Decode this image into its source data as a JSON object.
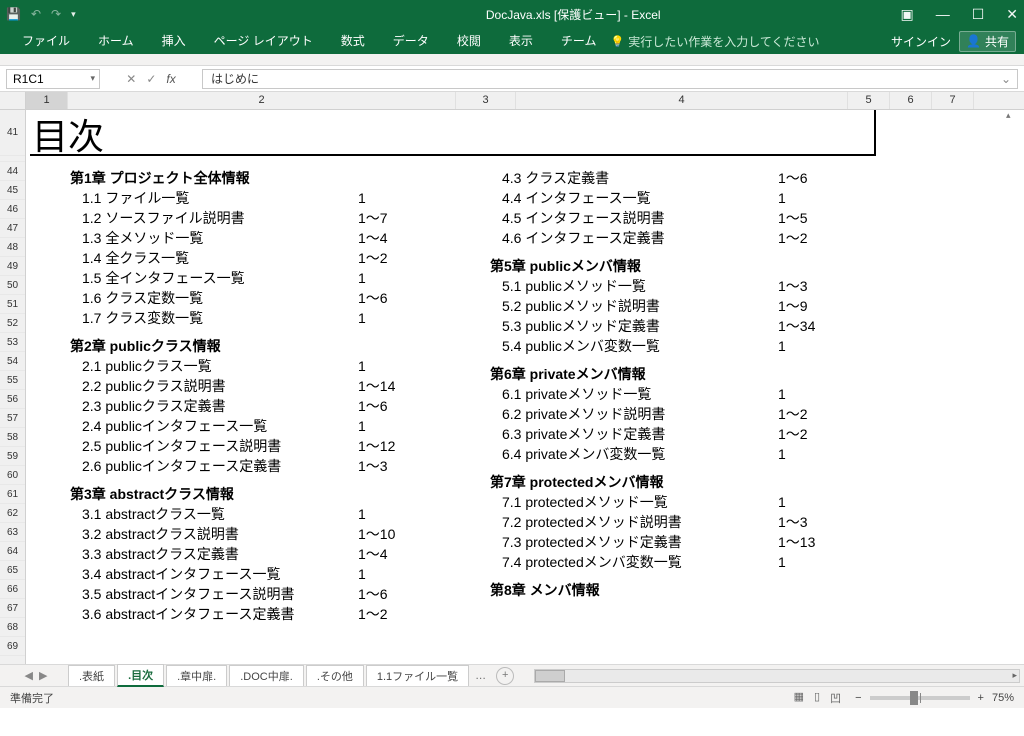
{
  "titlebar": {
    "doc_title": "DocJava.xls  [保護ビュー] - Excel"
  },
  "ribbon": {
    "tabs": [
      "ファイル",
      "ホーム",
      "挿入",
      "ページ レイアウト",
      "数式",
      "データ",
      "校閲",
      "表示",
      "チーム"
    ],
    "tell_me": "実行したい作業を入力してください",
    "signin": "サインイン",
    "share": "共有"
  },
  "fbar": {
    "namebox": "R1C1",
    "formula": "はじめに"
  },
  "columns": {
    "c1": "1",
    "c2": "2",
    "c3": "3",
    "c4": "4",
    "c5": "5",
    "c6": "6",
    "c7": "7"
  },
  "rows": [
    "41",
    "",
    "44",
    "45",
    "46",
    "47",
    "48",
    "49",
    "50",
    "51",
    "52",
    "53",
    "54",
    "55",
    "56",
    "57",
    "58",
    "59",
    "60",
    "61",
    "62",
    "63",
    "64",
    "65",
    "66",
    "67",
    "68",
    "69"
  ],
  "doc": {
    "title": "目次",
    "left": {
      "ch1": "第1章 プロジェクト全体情報",
      "s1_1": "1.1 ファイル一覧",
      "p1_1": "1",
      "s1_2": "1.2 ソースファイル説明書",
      "p1_2": "1～7",
      "s1_3": "1.3 全メソッド一覧",
      "p1_3": "1～4",
      "s1_4": "1.4 全クラス一覧",
      "p1_4": "1～2",
      "s1_5": "1.5 全インタフェース一覧",
      "p1_5": "1",
      "s1_6": "1.6 クラス定数一覧",
      "p1_6": "1～6",
      "s1_7": "1.7 クラス変数一覧",
      "p1_7": "1",
      "ch2": "第2章 publicクラス情報",
      "s2_1": "2.1 publicクラス一覧",
      "p2_1": "1",
      "s2_2": "2.2 publicクラス説明書",
      "p2_2": "1～14",
      "s2_3": "2.3 publicクラス定義書",
      "p2_3": "1～6",
      "s2_4": "2.4 publicインタフェース一覧",
      "p2_4": "1",
      "s2_5": "2.5 publicインタフェース説明書",
      "p2_5": "1～12",
      "s2_6": "2.6 publicインタフェース定義書",
      "p2_6": "1～3",
      "ch3": "第3章 abstractクラス情報",
      "s3_1": "3.1 abstractクラス一覧",
      "p3_1": "1",
      "s3_2": "3.2 abstractクラス説明書",
      "p3_2": "1～10",
      "s3_3": "3.3 abstractクラス定義書",
      "p3_3": "1～4",
      "s3_4": "3.4 abstractインタフェース一覧",
      "p3_4": "1",
      "s3_5": "3.5 abstractインタフェース説明書",
      "p3_5": "1～6",
      "s3_6": "3.6 abstractインタフェース定義書",
      "p3_6": "1～2"
    },
    "right": {
      "s4_3": "4.3 クラス定義書",
      "p4_3": "1～6",
      "s4_4": "4.4 インタフェース一覧",
      "p4_4": "1",
      "s4_5": "4.5 インタフェース説明書",
      "p4_5": "1～5",
      "s4_6": "4.6 インタフェース定義書",
      "p4_6": "1～2",
      "ch5": "第5章 publicメンバ情報",
      "s5_1": "5.1 publicメソッド一覧",
      "p5_1": "1～3",
      "s5_2": "5.2 publicメソッド説明書",
      "p5_2": "1～9",
      "s5_3": "5.3 publicメソッド定義書",
      "p5_3": "1～34",
      "s5_4": "5.4 publicメンバ変数一覧",
      "p5_4": "1",
      "ch6": "第6章 privateメンバ情報",
      "s6_1": "6.1 privateメソッド一覧",
      "p6_1": "1",
      "s6_2": "6.2 privateメソッド説明書",
      "p6_2": "1～2",
      "s6_3": "6.3 privateメソッド定義書",
      "p6_3": "1～2",
      "s6_4": "6.4 privateメンバ変数一覧",
      "p6_4": "1",
      "ch7": "第7章 protectedメンバ情報",
      "s7_1": "7.1 protectedメソッド一覧",
      "p7_1": "1",
      "s7_2": "7.2 protectedメソッド説明書",
      "p7_2": "1～3",
      "s7_3": "7.3 protectedメソッド定義書",
      "p7_3": "1～13",
      "s7_4": "7.4 protectedメンバ変数一覧",
      "p7_4": "1",
      "ch8": "第8章 メンバ情報"
    }
  },
  "sheets": {
    "t1": ".表紙",
    "t2": ".目次",
    "t3": ".章中扉.",
    "t4": ".DOC中扉.",
    "t5": ".その他",
    "t6": "1.1ファイル一覧",
    "more": "…"
  },
  "status": {
    "ready": "準備完了",
    "zoom": "75%"
  }
}
